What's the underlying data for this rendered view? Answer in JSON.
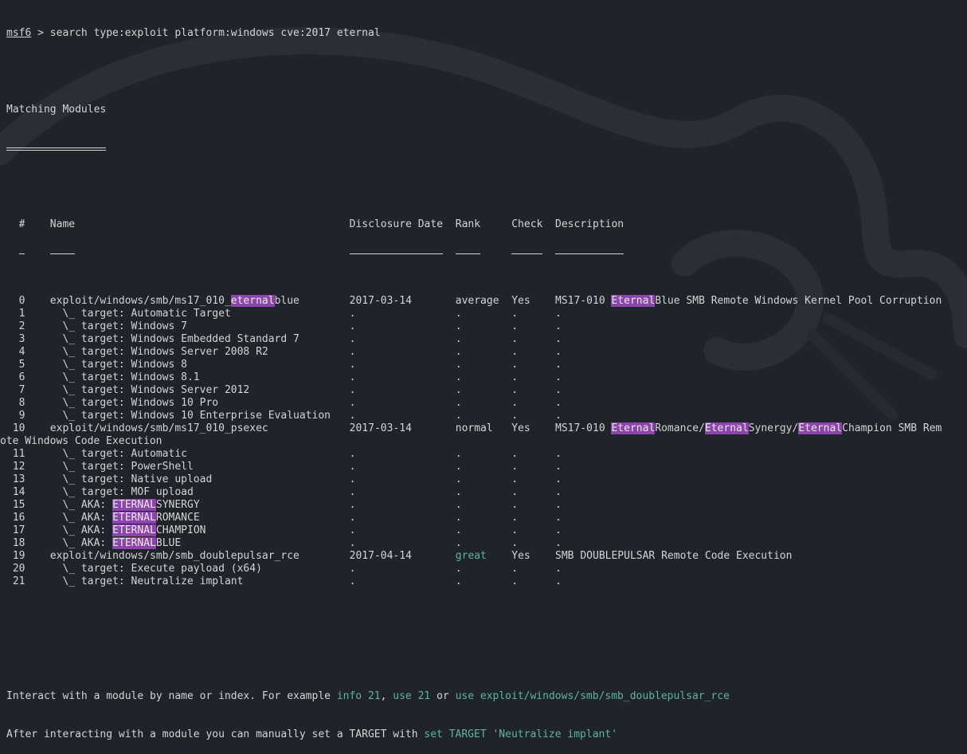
{
  "prompt": {
    "name": "msf6",
    "command": " > search type:exploit platform:windows cve:2017 eternal"
  },
  "section_title": "Matching Modules",
  "section_underline": "================",
  "columns": [
    "#",
    "Name",
    "Disclosure Date",
    "Rank",
    "Check",
    "Description"
  ],
  "column_underlines": [
    "-",
    "----",
    "---------------",
    "----",
    "-----",
    "-----------"
  ],
  "rows": [
    {
      "num": "0",
      "name": "exploit/windows/smb/ms17_010_eternalblue",
      "date": "2017-03-14",
      "rank": "average",
      "check": "Yes",
      "desc": "MS17-010 EternalBlue SMB Remote Windows Kernel Pool Corruption"
    },
    {
      "num": "1",
      "name": "  \\_ target: Automatic Target",
      "date": ".",
      "rank": ".",
      "check": ".",
      "desc": "."
    },
    {
      "num": "2",
      "name": "  \\_ target: Windows 7",
      "date": ".",
      "rank": ".",
      "check": ".",
      "desc": "."
    },
    {
      "num": "3",
      "name": "  \\_ target: Windows Embedded Standard 7",
      "date": ".",
      "rank": ".",
      "check": ".",
      "desc": "."
    },
    {
      "num": "4",
      "name": "  \\_ target: Windows Server 2008 R2",
      "date": ".",
      "rank": ".",
      "check": ".",
      "desc": "."
    },
    {
      "num": "5",
      "name": "  \\_ target: Windows 8",
      "date": ".",
      "rank": ".",
      "check": ".",
      "desc": "."
    },
    {
      "num": "6",
      "name": "  \\_ target: Windows 8.1",
      "date": ".",
      "rank": ".",
      "check": ".",
      "desc": "."
    },
    {
      "num": "7",
      "name": "  \\_ target: Windows Server 2012",
      "date": ".",
      "rank": ".",
      "check": ".",
      "desc": "."
    },
    {
      "num": "8",
      "name": "  \\_ target: Windows 10 Pro",
      "date": ".",
      "rank": ".",
      "check": ".",
      "desc": "."
    },
    {
      "num": "9",
      "name": "  \\_ target: Windows 10 Enterprise Evaluation",
      "date": ".",
      "rank": ".",
      "check": ".",
      "desc": "."
    },
    {
      "num": "10",
      "name": "exploit/windows/smb/ms17_010_psexec",
      "date": "2017-03-14",
      "rank": "normal",
      "check": "Yes",
      "desc": "MS17-010 EternalRomance/EternalSynergy/EternalChampion SMB Rem",
      "wrap": "ote Windows Code Execution"
    },
    {
      "num": "11",
      "name": "  \\_ target: Automatic",
      "date": ".",
      "rank": ".",
      "check": ".",
      "desc": "."
    },
    {
      "num": "12",
      "name": "  \\_ target: PowerShell",
      "date": ".",
      "rank": ".",
      "check": ".",
      "desc": "."
    },
    {
      "num": "13",
      "name": "  \\_ target: Native upload",
      "date": ".",
      "rank": ".",
      "check": ".",
      "desc": "."
    },
    {
      "num": "14",
      "name": "  \\_ target: MOF upload",
      "date": ".",
      "rank": ".",
      "check": ".",
      "desc": "."
    },
    {
      "num": "15",
      "name": "  \\_ AKA: ETERNALSYNERGY",
      "date": ".",
      "rank": ".",
      "check": ".",
      "desc": "."
    },
    {
      "num": "16",
      "name": "  \\_ AKA: ETERNALROMANCE",
      "date": ".",
      "rank": ".",
      "check": ".",
      "desc": "."
    },
    {
      "num": "17",
      "name": "  \\_ AKA: ETERNALCHAMPION",
      "date": ".",
      "rank": ".",
      "check": ".",
      "desc": "."
    },
    {
      "num": "18",
      "name": "  \\_ AKA: ETERNALBLUE",
      "date": ".",
      "rank": ".",
      "check": ".",
      "desc": "."
    },
    {
      "num": "19",
      "name": "exploit/windows/smb/smb_doublepulsar_rce",
      "date": "2017-04-14",
      "rank": "great",
      "check": "Yes",
      "desc": "SMB DOUBLEPULSAR Remote Code Execution"
    },
    {
      "num": "20",
      "name": "  \\_ target: Execute payload (x64)",
      "date": ".",
      "rank": ".",
      "check": ".",
      "desc": "."
    },
    {
      "num": "21",
      "name": "  \\_ target: Neutralize implant",
      "date": ".",
      "rank": ".",
      "check": ".",
      "desc": "."
    }
  ],
  "footer": {
    "line1": [
      {
        "text": "Interact with a module by name or index. For example ",
        "style": "plain"
      },
      {
        "text": "info 21",
        "style": "teal"
      },
      {
        "text": ", ",
        "style": "plain"
      },
      {
        "text": "use 21",
        "style": "teal"
      },
      {
        "text": " or ",
        "style": "plain"
      },
      {
        "text": "use exploit/windows/smb/smb_doublepulsar_rce",
        "style": "teal"
      }
    ],
    "line2": [
      {
        "text": "After interacting with a module you can manually set a TARGET with ",
        "style": "plain"
      },
      {
        "text": "set TARGET 'Neutralize implant'",
        "style": "teal"
      }
    ]
  },
  "highlight_terms": [
    "eternal",
    "Eternal",
    "ETERNAL"
  ],
  "colors": {
    "background": "#1f232a",
    "text": "#d4d4d4",
    "highlight": "#8e44ad",
    "accent_teal": "#5fb3a3"
  },
  "background_watermark": "kali-dragon-icon"
}
